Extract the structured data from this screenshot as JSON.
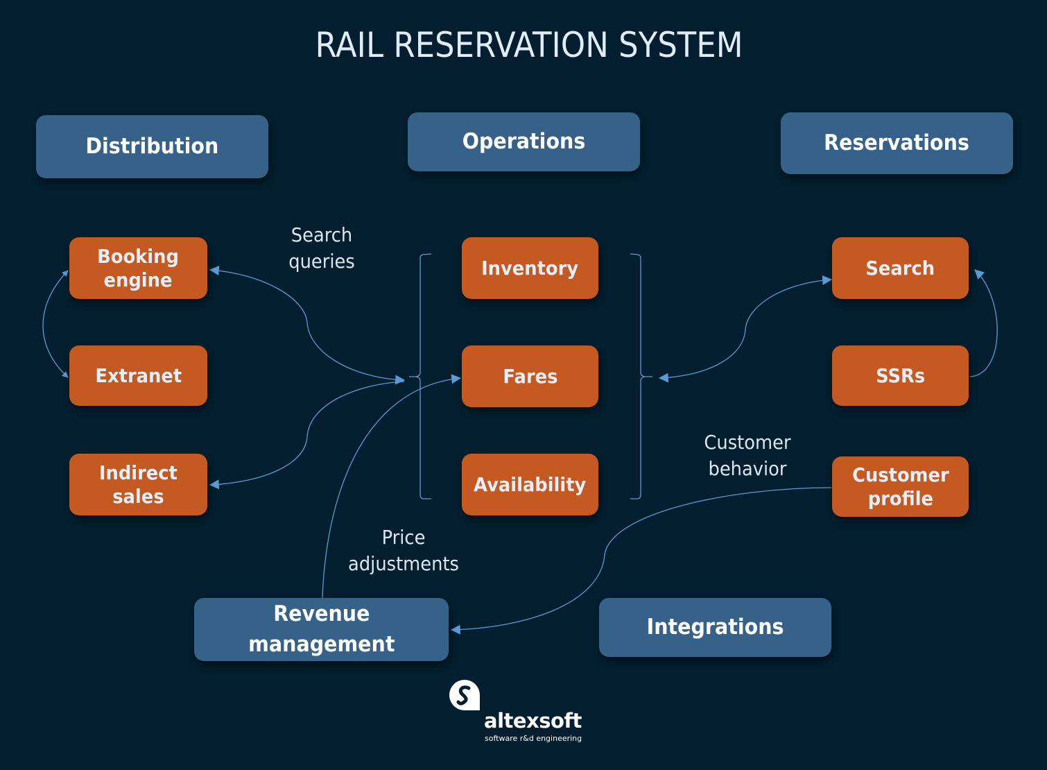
{
  "title": "RAIL RESERVATION SYSTEM",
  "colors": {
    "background": "#031f2f",
    "category_box": "#366189",
    "component_box": "#c45a21",
    "connector": "#5b9bd5",
    "text": "#e9eef7"
  },
  "categories": {
    "distribution": "Distribution",
    "operations": "Operations",
    "reservations": "Reservations",
    "revenue": "Revenue\nmanagement",
    "integrations": "Integrations"
  },
  "components": {
    "booking_engine": "Booking\nengine",
    "extranet": "Extranet",
    "indirect_sales": "Indirect\nsales",
    "inventory": "Inventory",
    "fares": "Fares",
    "availability": "Availability",
    "search": "Search",
    "ssrs": "SSRs",
    "customer_profile": "Customer\nprofile"
  },
  "flow_labels": {
    "search_queries": "Search\nqueries",
    "price_adjustments": "Price\nadjustments",
    "customer_behavior": "Customer\nbehavior"
  },
  "connections": [
    {
      "from": "Booking engine",
      "to": "Extranet",
      "direction": "bidirectional"
    },
    {
      "from": "Operations group",
      "to": "Booking engine",
      "direction": "bidirectional",
      "label": "Search queries"
    },
    {
      "from": "Operations group",
      "to": "Indirect sales",
      "direction": "bidirectional"
    },
    {
      "from": "Reservations: Search",
      "to": "Operations group",
      "direction": "bidirectional"
    },
    {
      "from": "SSRs",
      "to": "Search",
      "direction": "one-way"
    },
    {
      "from": "Revenue management",
      "to": "Fares",
      "direction": "one-way",
      "label": "Price adjustments"
    },
    {
      "from": "Customer profile",
      "to": "Revenue management",
      "direction": "one-way",
      "label": "Customer behavior"
    }
  ],
  "logo": {
    "name": "altexsoft",
    "tagline": "software r&d engineering"
  }
}
